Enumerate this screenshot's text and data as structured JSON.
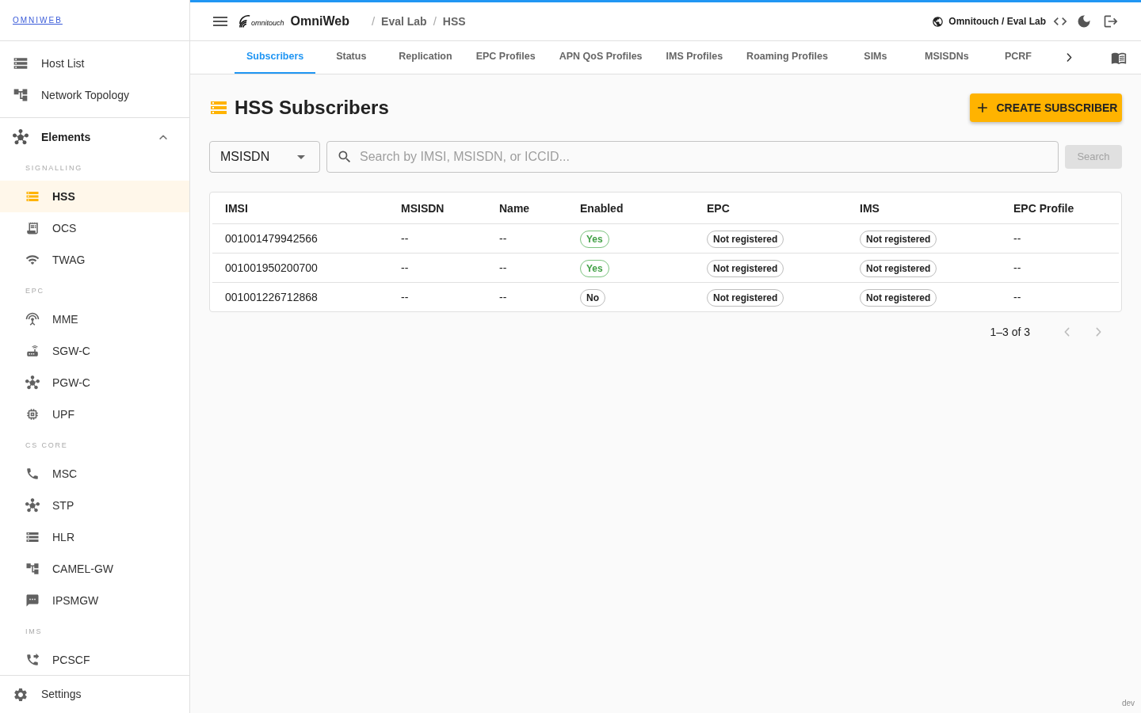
{
  "sidebar": {
    "brand": "OMNIWEB",
    "nav": [
      {
        "label": "Host List"
      },
      {
        "label": "Network Topology"
      }
    ],
    "group": {
      "label": "Elements",
      "expanded": true,
      "sections": [
        {
          "heading": "SIGNALLING",
          "items": [
            {
              "label": "HSS",
              "selected": true
            },
            {
              "label": "OCS",
              "selected": false
            },
            {
              "label": "TWAG",
              "selected": false
            }
          ]
        },
        {
          "heading": "EPC",
          "items": [
            {
              "label": "MME",
              "selected": false
            },
            {
              "label": "SGW-C",
              "selected": false
            },
            {
              "label": "PGW-C",
              "selected": false
            },
            {
              "label": "UPF",
              "selected": false
            }
          ]
        },
        {
          "heading": "CS CORE",
          "items": [
            {
              "label": "MSC",
              "selected": false
            },
            {
              "label": "STP",
              "selected": false
            },
            {
              "label": "HLR",
              "selected": false
            },
            {
              "label": "CAMEL-GW",
              "selected": false
            },
            {
              "label": "IPSMGW",
              "selected": false
            }
          ]
        },
        {
          "heading": "IMS",
          "items": [
            {
              "label": "PCSCF",
              "selected": false
            }
          ]
        }
      ]
    },
    "footer": {
      "label": "Settings"
    }
  },
  "header": {
    "logo_text": "omnitouch",
    "app_name": "OmniWeb",
    "separator": "/",
    "breadcrumb": [
      "Eval Lab",
      "HSS"
    ],
    "tenant": "Omnitouch / Eval Lab"
  },
  "tabs": [
    {
      "label": "Subscribers",
      "selected": true
    },
    {
      "label": "Status",
      "selected": false
    },
    {
      "label": "Replication",
      "selected": false
    },
    {
      "label": "EPC Profiles",
      "selected": false
    },
    {
      "label": "APN QoS Profiles",
      "selected": false
    },
    {
      "label": "IMS Profiles",
      "selected": false
    },
    {
      "label": "Roaming Profiles",
      "selected": false
    },
    {
      "label": "SIMs",
      "selected": false
    },
    {
      "label": "MSISDNs",
      "selected": false
    },
    {
      "label": "PCRF",
      "selected": false
    }
  ],
  "page": {
    "title": "HSS Subscribers",
    "create_button": "CREATE SUBSCRIBER",
    "filter": {
      "field": "MSISDN",
      "placeholder": "Search by IMSI, MSISDN, or ICCID...",
      "button": "Search",
      "button_disabled": true
    },
    "table": {
      "columns": [
        {
          "label": "IMSI",
          "kind": "text"
        },
        {
          "label": "MSISDN",
          "kind": "text"
        },
        {
          "label": "Name",
          "kind": "text"
        },
        {
          "label": "Enabled",
          "kind": "flag"
        },
        {
          "label": "EPC",
          "kind": "chip"
        },
        {
          "label": "IMS",
          "kind": "chip"
        },
        {
          "label": "EPC Profile",
          "kind": "text"
        }
      ],
      "rows": [
        {
          "cells": [
            {
              "text": "001001479942566"
            },
            {
              "text": "--"
            },
            {
              "text": "--"
            },
            {
              "text": "Yes",
              "enabled": true
            },
            {
              "text": "Not registered"
            },
            {
              "text": "Not registered"
            },
            {
              "text": "--"
            }
          ]
        },
        {
          "cells": [
            {
              "text": "001001950200700"
            },
            {
              "text": "--"
            },
            {
              "text": "--"
            },
            {
              "text": "Yes",
              "enabled": true
            },
            {
              "text": "Not registered"
            },
            {
              "text": "Not registered"
            },
            {
              "text": "--"
            }
          ]
        },
        {
          "cells": [
            {
              "text": "001001226712868"
            },
            {
              "text": "--"
            },
            {
              "text": "--"
            },
            {
              "text": "No",
              "enabled": false
            },
            {
              "text": "Not registered"
            },
            {
              "text": "Not registered"
            },
            {
              "text": "--"
            }
          ]
        }
      ]
    },
    "pagination": {
      "range": "1–3 of 3",
      "prev_disabled": true,
      "next_disabled": true
    }
  },
  "env_label": "dev"
}
